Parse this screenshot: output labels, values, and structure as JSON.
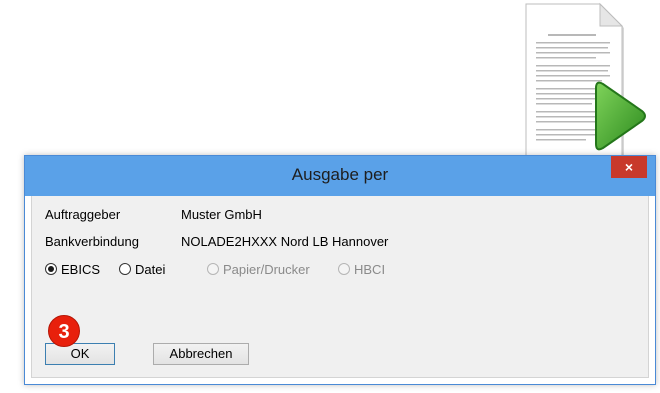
{
  "dialog": {
    "title": "Ausgabe per",
    "close_symbol": "×",
    "fields": [
      {
        "label": "Auftraggeber",
        "value": "Muster GmbH"
      },
      {
        "label": "Bankverbindung",
        "value": "NOLADE2HXXX Nord LB Hannover"
      }
    ],
    "radios": [
      {
        "label": "EBICS",
        "checked": true,
        "enabled": true
      },
      {
        "label": "Datei",
        "checked": false,
        "enabled": true
      },
      {
        "label": "Papier/Drucker",
        "checked": false,
        "enabled": false
      },
      {
        "label": "HBCI",
        "checked": false,
        "enabled": false
      }
    ],
    "ok_label": "OK",
    "cancel_label": "Abbrechen"
  },
  "step_badge": "3",
  "icons": {
    "document": "document-icon",
    "play": "play-arrow-icon",
    "close": "close-icon"
  },
  "colors": {
    "titlebar": "#5aa1e8",
    "close_button": "#c8392b",
    "badge": "#e8200c",
    "play_arrow": "#3fa52a"
  }
}
